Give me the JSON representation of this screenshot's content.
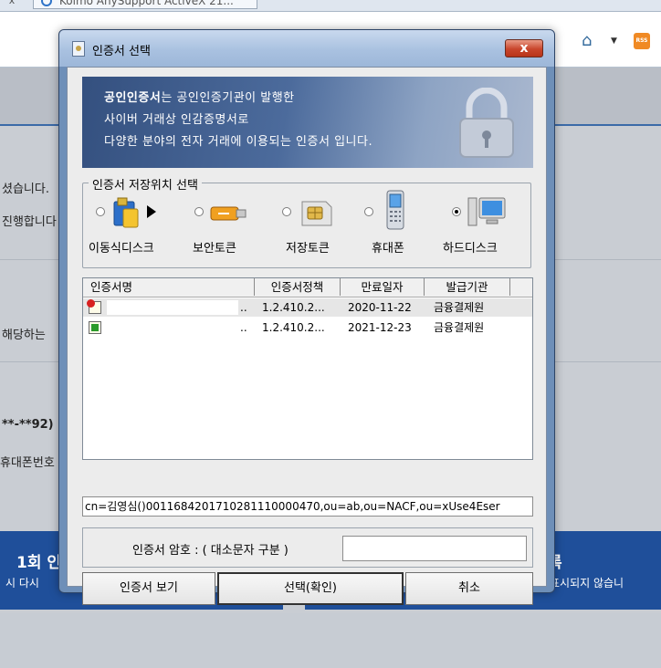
{
  "browser": {
    "tab_label": "Kolmo AnySupport ActiveX 21...",
    "tab_close": "x",
    "rss_label": "RSS"
  },
  "background": {
    "line1": "셨습니다.",
    "line2": "진행합니다",
    "line3": "해당하는",
    "line4": "**-**92)",
    "line5": "휴대폰번호",
    "banner_left_title": "1회 인",
    "banner_left_sub": "시 다시 ",
    "banner_right_title": "록",
    "banner_right_sub": "표시되지 않습니"
  },
  "dialog": {
    "title": "인증서 선택",
    "close_label": "x",
    "banner": {
      "bold_text": "공인인증서",
      "line1_rest": "는 공인인증기관이 발행한",
      "line2": "사이버 거래상 인감증명서로",
      "line3": "다양한 분야의 전자 거래에 이용되는 인증서 입니다."
    },
    "storage": {
      "label": "인증서 저장위치 선택",
      "locations": [
        {
          "label": "이동식디스크",
          "selected": false,
          "icon": "usb-disk-icon"
        },
        {
          "label": "보안토큰",
          "selected": false,
          "icon": "security-token-icon"
        },
        {
          "label": "저장토큰",
          "selected": false,
          "icon": "storage-token-icon"
        },
        {
          "label": "휴대폰",
          "selected": false,
          "icon": "mobile-phone-icon"
        },
        {
          "label": "하드디스크",
          "selected": true,
          "icon": "hard-disk-icon"
        }
      ]
    },
    "cert_list": {
      "headers": [
        "인증서명",
        "인증서정책",
        "만료일자",
        "발급기관"
      ],
      "rows": [
        {
          "name_suffix": "..",
          "policy": "1.2.410.2...",
          "expiry": "2020-11-22",
          "issuer": "금융결제원",
          "status": "expired"
        },
        {
          "name_suffix": "..",
          "policy": "1.2.410.2...",
          "expiry": "2021-12-23",
          "issuer": "금융결제원",
          "status": "valid"
        }
      ]
    },
    "dn_text": "cn=김영심()0011684201710281110000470,ou=ab,ou=NACF,ou=xUse4Eser",
    "password_label": "인증서 암호 : ( 대소문자 구분 )",
    "password_value": "",
    "buttons": {
      "view": "인증서 보기",
      "ok": "선택(확인)",
      "cancel": "취소"
    }
  }
}
